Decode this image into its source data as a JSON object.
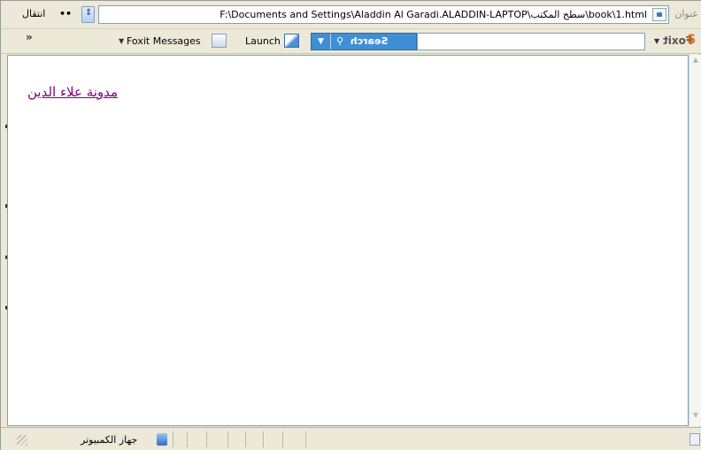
{
  "address_bar": {
    "label": "عنوان",
    "path": "F:\\Documents and Settings\\Aladdin Al Garadi.ALADDIN-LAPTOP\\سطح المكتب\\book\\1.html",
    "go_label": "انتقال",
    "go_arrow": "••"
  },
  "toolbar": {
    "chevrons": "»",
    "foxit_messages": "Foxit Messages",
    "launch": "Launch",
    "search": "Search",
    "search_value": "",
    "foxit_logo": "Foxit"
  },
  "content": {
    "link_text": "مدونة علاء الدين"
  },
  "status_bar": {
    "zone": "جهاز الكمبيوتر"
  },
  "icons": {
    "search": "magnifier-icon",
    "foxit_messages": "foxit-messages-icon",
    "launch": "launch-icon",
    "page": "html-page-icon",
    "zone": "computer-icon"
  },
  "colors": {
    "link_visited": "#800080",
    "search_button": "#3f8fd6",
    "foxit_accent": "#e06a1a"
  }
}
